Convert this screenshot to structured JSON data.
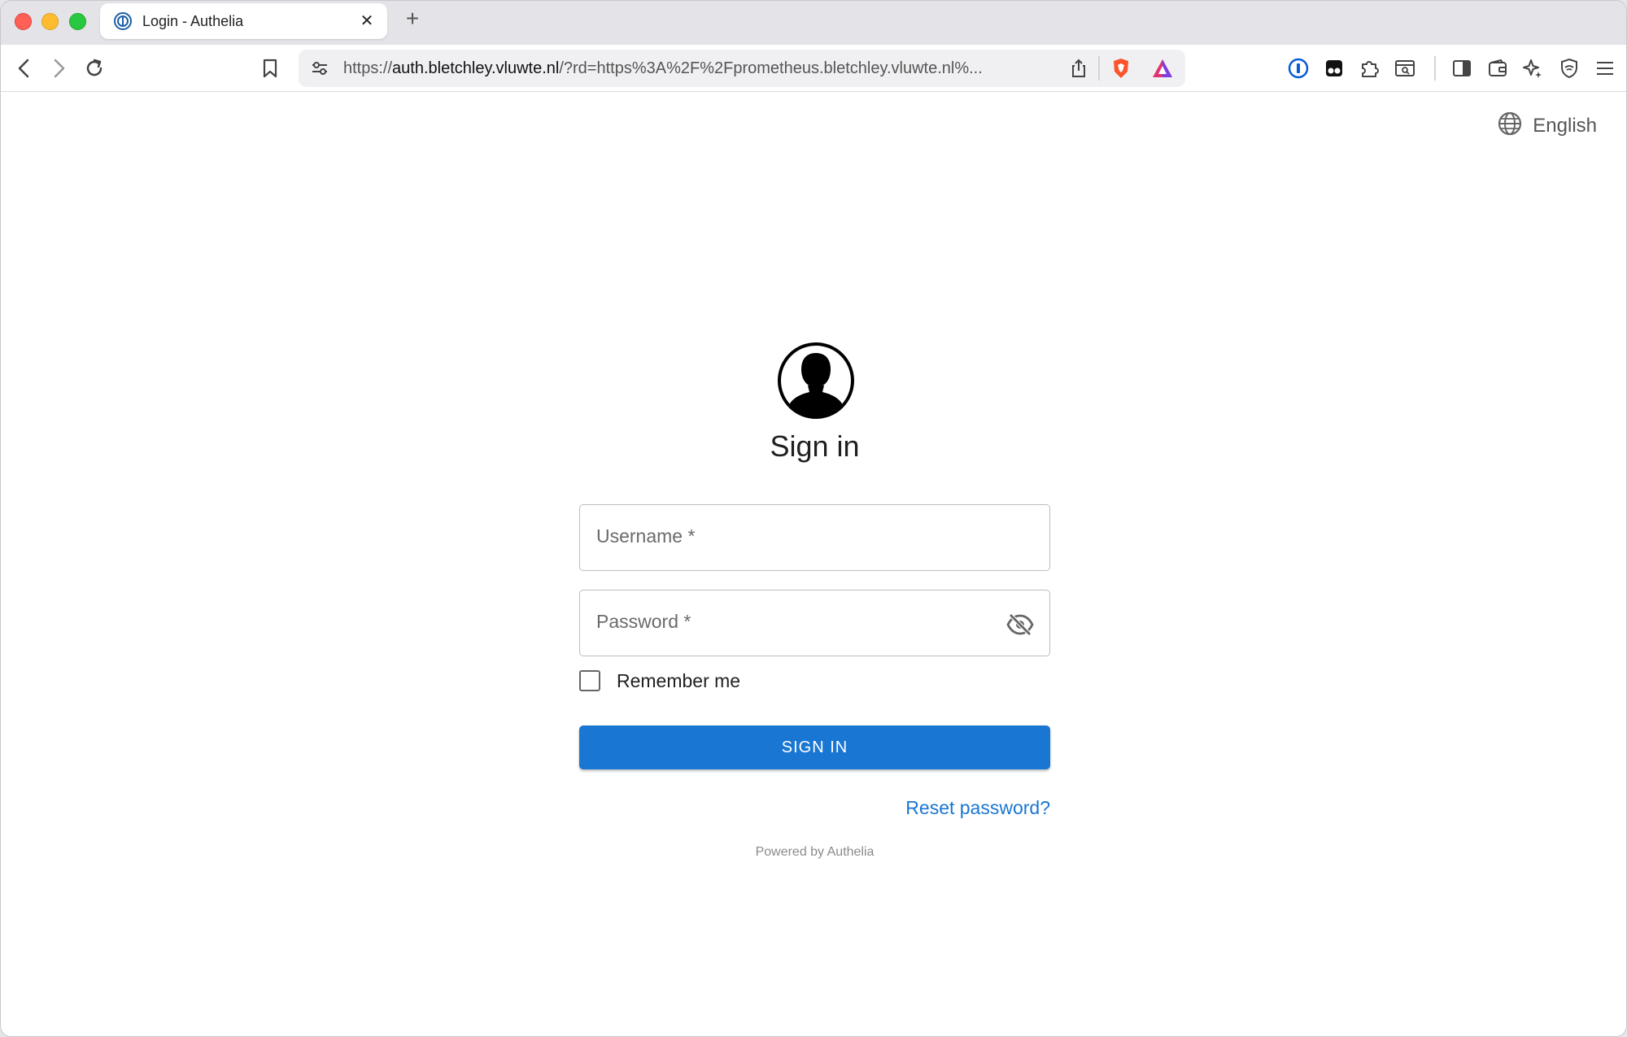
{
  "browser": {
    "tab": {
      "title": "Login - Authelia",
      "close": "✕"
    },
    "new_tab": "+",
    "url": {
      "scheme": "https://",
      "host": "auth.bletchley.vluwte.nl",
      "rest": "/?rd=https%3A%2F%2Fprometheus.bletchley.vluwte.nl%..."
    }
  },
  "page": {
    "language": "English",
    "login": {
      "title": "Sign in",
      "username_label": "Username *",
      "password_label": "Password *",
      "remember_label": "Remember me",
      "remember_checked": false,
      "signin_label": "SIGN IN",
      "reset_label": "Reset password?",
      "powered_by": "Powered by Authelia"
    }
  },
  "colors": {
    "primary": "#1976d2",
    "close_red": "#fe5f57",
    "minimize_yellow": "#febc2e",
    "maximize_green": "#28c840"
  },
  "icons": [
    "back-icon",
    "forward-icon",
    "reload-icon",
    "bookmark-icon",
    "site-settings-icon",
    "share-icon",
    "brave-shields-icon",
    "brave-rewards-icon",
    "onepassword-icon",
    "extension-icon",
    "puzzle-icon",
    "tab-search-icon",
    "sidebar-icon",
    "wallet-icon",
    "leo-ai-icon",
    "vpn-shield-icon",
    "menu-icon",
    "globe-icon",
    "avatar-icon",
    "eye-off-icon"
  ]
}
